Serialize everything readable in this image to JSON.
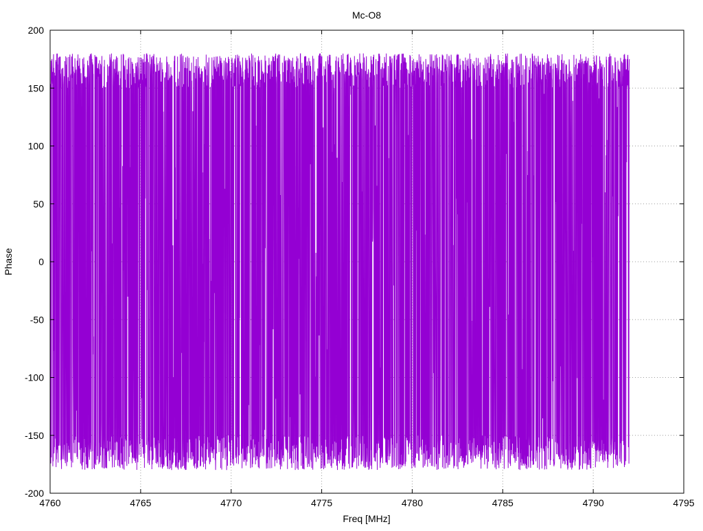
{
  "chart_data": {
    "type": "line",
    "title": "Mc-O8",
    "xlabel": "Freq [MHz]",
    "ylabel": "Phase",
    "xlim": [
      4760,
      4795
    ],
    "ylim": [
      -200,
      200
    ],
    "x_ticks": [
      4760,
      4765,
      4770,
      4775,
      4780,
      4785,
      4790,
      4795
    ],
    "y_ticks": [
      -200,
      -150,
      -100,
      -50,
      0,
      50,
      100,
      150,
      200
    ],
    "grid": true,
    "legend": "none",
    "series": [
      {
        "color": "#9400D3",
        "x_start": 4760.0,
        "x_end": 4792.0,
        "y_min": -180,
        "y_max": 180,
        "pattern": "dense phase wrapping between -180 and 180 across the full range"
      }
    ]
  },
  "colors": {
    "series": "#9400D3",
    "grid": "#9a9a9a",
    "axis": "#000000",
    "background": "#ffffff"
  }
}
